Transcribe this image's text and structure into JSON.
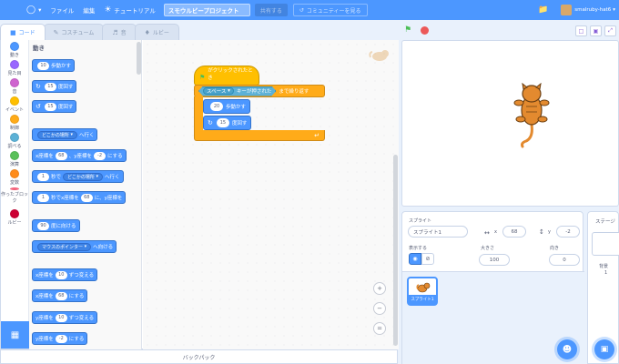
{
  "menubar": {
    "file": "ファイル",
    "edit": "編集",
    "tutorial": "チュートリアル",
    "project_title": "スモウルビープロジェクト",
    "share": "共有する",
    "community": "コミュニティーを見る",
    "username": "smalruby-hat6"
  },
  "tabs": {
    "code": "コード",
    "costume": "コスチューム",
    "sound": "音",
    "ruby": "ルビー"
  },
  "categories": [
    {
      "label": "動き",
      "color": "#4c97ff"
    },
    {
      "label": "見た目",
      "color": "#9966ff"
    },
    {
      "label": "音",
      "color": "#cf63cf"
    },
    {
      "label": "イベント",
      "color": "#ffbf00"
    },
    {
      "label": "制御",
      "color": "#ffab19"
    },
    {
      "label": "調べる",
      "color": "#5cb1d6"
    },
    {
      "label": "演算",
      "color": "#59c059"
    },
    {
      "label": "変数",
      "color": "#ff8c1a"
    },
    {
      "label": "作ったブロック",
      "color": "#ff6680"
    },
    {
      "label": "ルビー",
      "color": "#cc0033"
    }
  ],
  "palette": {
    "heading": "動き",
    "move": {
      "value": "10",
      "text": "歩動かす"
    },
    "turn_right": {
      "value": "15",
      "text": "度回す"
    },
    "turn_left": {
      "value": "15",
      "text": "度回す"
    },
    "goto": {
      "drop": "どこかの場所",
      "text": "へ行く"
    },
    "goto_xy": {
      "t1": "x座標を",
      "x": "68",
      "t2": "、y座標を",
      "y": "-2",
      "t3": "にする"
    },
    "glide": {
      "value": "1",
      "t1": "秒で",
      "drop": "どこかの場所",
      "t2": "へ行く"
    },
    "glide_xy": {
      "value": "1",
      "t1": "秒でx座標を",
      "x": "68",
      "t2": "に、y座標を"
    },
    "point_dir": {
      "value": "90",
      "text": "度に向ける"
    },
    "point_towards": {
      "drop": "マウスのポインター",
      "text": "へ向ける"
    },
    "change_x": {
      "t1": "x座標を",
      "value": "10",
      "t2": "ずつ変える"
    },
    "set_x": {
      "t1": "x座標を",
      "value": "68",
      "t2": "にする"
    },
    "change_y": {
      "t1": "y座標を",
      "value": "10",
      "t2": "ずつ変える"
    },
    "set_y": {
      "t1": "y座標を",
      "value": "-2",
      "t2": "にする"
    }
  },
  "script": {
    "hat": "がクリックされたとき",
    "forever_key": "スペース",
    "forever_cond": "キーが押された",
    "forever_text": "まで繰り返す",
    "move": {
      "value": "20",
      "text": "歩動かす"
    },
    "turn": {
      "value": "15",
      "text": "度回す"
    }
  },
  "zoom": {
    "in": "+",
    "out": "−",
    "reset": "="
  },
  "backpack": "バックパック",
  "sprite_info": {
    "sprite_label": "スプライト",
    "sprite_name": "スプライト1",
    "x_label": "x",
    "x_value": "68",
    "y_label": "y",
    "y_value": "-2",
    "show_label": "表示する",
    "size_label": "大きさ",
    "size_value": "100",
    "direction_label": "向き",
    "direction_value": "0"
  },
  "sprite_list": {
    "thumb_name": "スプライト1"
  },
  "stage_pane": {
    "title": "ステージ",
    "backdrop_label": "背景",
    "backdrop_count": "1"
  },
  "colors": {
    "accent": "#4c97ff",
    "events": "#ffbf00",
    "control": "#ffab19",
    "sensing": "#5cb1d6"
  }
}
